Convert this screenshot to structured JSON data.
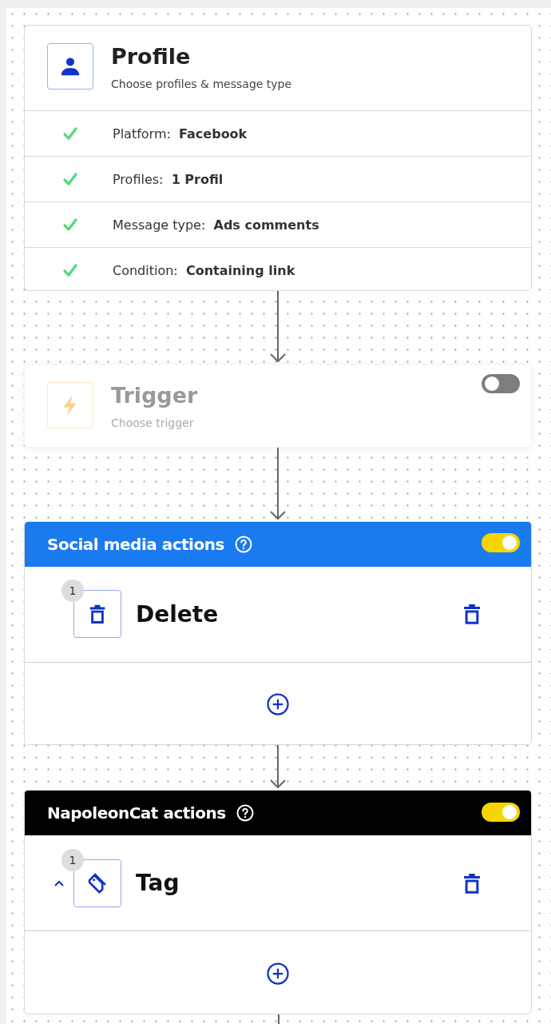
{
  "profile": {
    "title": "Profile",
    "subtitle": "Choose profiles & message type",
    "items": [
      {
        "label": "Platform:",
        "value": "Facebook",
        "done": true
      },
      {
        "label": "Profiles:",
        "value": "1 Profil",
        "done": true
      },
      {
        "label": "Message type:",
        "value": "Ads comments",
        "done": true
      },
      {
        "label": "Condition:",
        "value": "Containing link",
        "done": true
      }
    ]
  },
  "trigger": {
    "title": "Trigger",
    "subtitle": "Choose trigger",
    "enabled": false
  },
  "action_groups": [
    {
      "title": "Social media actions",
      "color": "#1a7af0",
      "enabled": true,
      "actions": [
        {
          "number": "1",
          "name": "Delete",
          "kind": "delete"
        }
      ]
    },
    {
      "title": "NapoleonCat actions",
      "color": "#000000",
      "enabled": true,
      "actions": [
        {
          "number": "1",
          "name": "Tag",
          "kind": "tag",
          "expanded": true
        }
      ]
    }
  ]
}
